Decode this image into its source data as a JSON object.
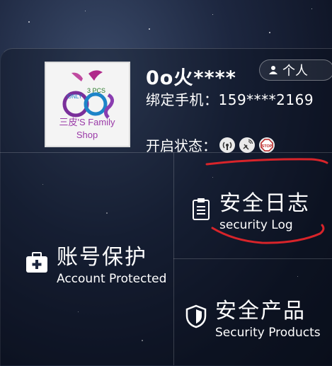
{
  "user": {
    "name": "0o火****",
    "phone_label": "绑定手机：",
    "phone_value": "159****2169",
    "status_label": "开启状态："
  },
  "personal_button": {
    "label": "个人"
  },
  "avatar": {
    "shop_name_cn": "三皮'S Family",
    "shop_word": "Shop"
  },
  "tiles": [
    {
      "title": "安全日志",
      "subtitle": "security Log",
      "icon": "clipboard-icon"
    },
    {
      "title": "账号保护",
      "subtitle": "Account Protected",
      "icon": "medical-kit-icon"
    },
    {
      "title": "安全产品",
      "subtitle": "Security Products",
      "icon": "shield-icon"
    }
  ],
  "colors": {
    "annotation_red": "#d8242a"
  }
}
